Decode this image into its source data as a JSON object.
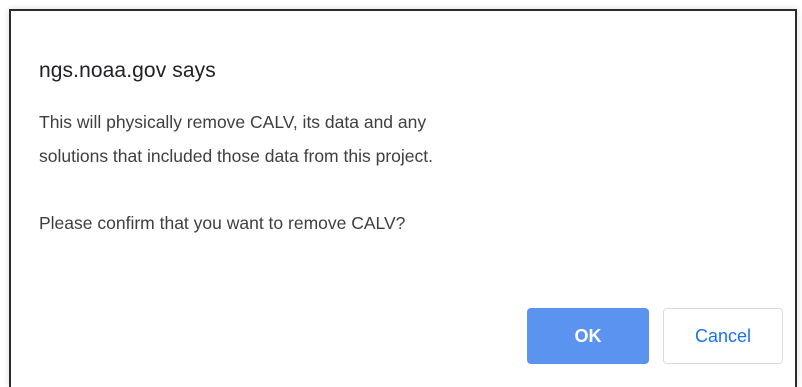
{
  "dialog": {
    "title": "ngs.noaa.gov says",
    "message_line1": "This will physically remove CALV, its data and any",
    "message_line2": "solutions that included those data from this project.",
    "message_question": "Please confirm that you want to remove CALV?",
    "ok_label": "OK",
    "cancel_label": "Cancel"
  },
  "colors": {
    "ok_button": "#5b93f1",
    "cancel_text": "#1a73e8"
  }
}
